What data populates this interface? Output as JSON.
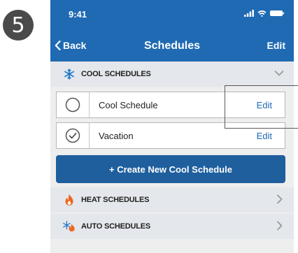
{
  "step": {
    "number": "5"
  },
  "status_bar": {
    "time": "9:41"
  },
  "nav": {
    "back_label": "Back",
    "title": "Schedules",
    "edit_label": "Edit"
  },
  "cool": {
    "title": "COOL SCHEDULES",
    "icon": "snowflake-icon",
    "expanded": true,
    "items": [
      {
        "label": "Cool Schedule",
        "edit_label": "Edit",
        "selected": false
      },
      {
        "label": "Vacation",
        "edit_label": "Edit",
        "selected": true
      }
    ],
    "create_label": "+ Create New Cool Schedule"
  },
  "heat": {
    "title": "HEAT SCHEDULES",
    "icon": "flame-icon"
  },
  "auto": {
    "title": "AUTO SCHEDULES",
    "icon": "snowflake-flame-icon"
  },
  "colors": {
    "header_blue": "#1f6ab3",
    "button_blue": "#1f5f9e",
    "section_bg": "#e4e7eb",
    "flame": "#f0661e",
    "snowflake": "#1e78c8"
  }
}
